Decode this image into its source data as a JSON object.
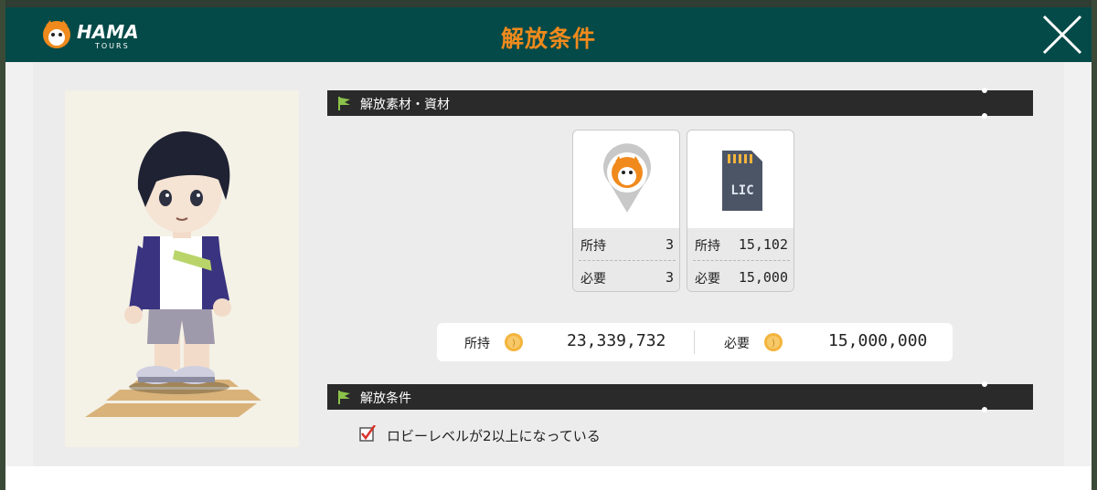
{
  "header": {
    "title": "解放条件",
    "logo_text": "HAMA",
    "logo_subtext": "TOURS"
  },
  "materials_section": {
    "label": "解放素材・資材",
    "items": [
      {
        "icon": "map-pin-mascot-icon",
        "own_label": "所持",
        "own_value": "3",
        "need_label": "必要",
        "need_value": "3"
      },
      {
        "icon": "license-card-icon",
        "icon_text": "LIC",
        "own_label": "所持",
        "own_value": "15,102",
        "need_label": "必要",
        "need_value": "15,000"
      }
    ]
  },
  "currency": {
    "own_label": "所持",
    "own_value": "23,339,732",
    "need_label": "必要",
    "need_value": "15,000,000"
  },
  "conditions_section": {
    "label": "解放条件",
    "items": [
      {
        "text": "ロビーレベルが2以上になっている",
        "checked": true
      }
    ]
  },
  "colors": {
    "header_bg": "#044a48",
    "title_orange": "#f08a1c",
    "section_bar_bg": "#2a2a2a",
    "flag_green": "#8bc34a",
    "coin_gold": "#f3b43c"
  }
}
